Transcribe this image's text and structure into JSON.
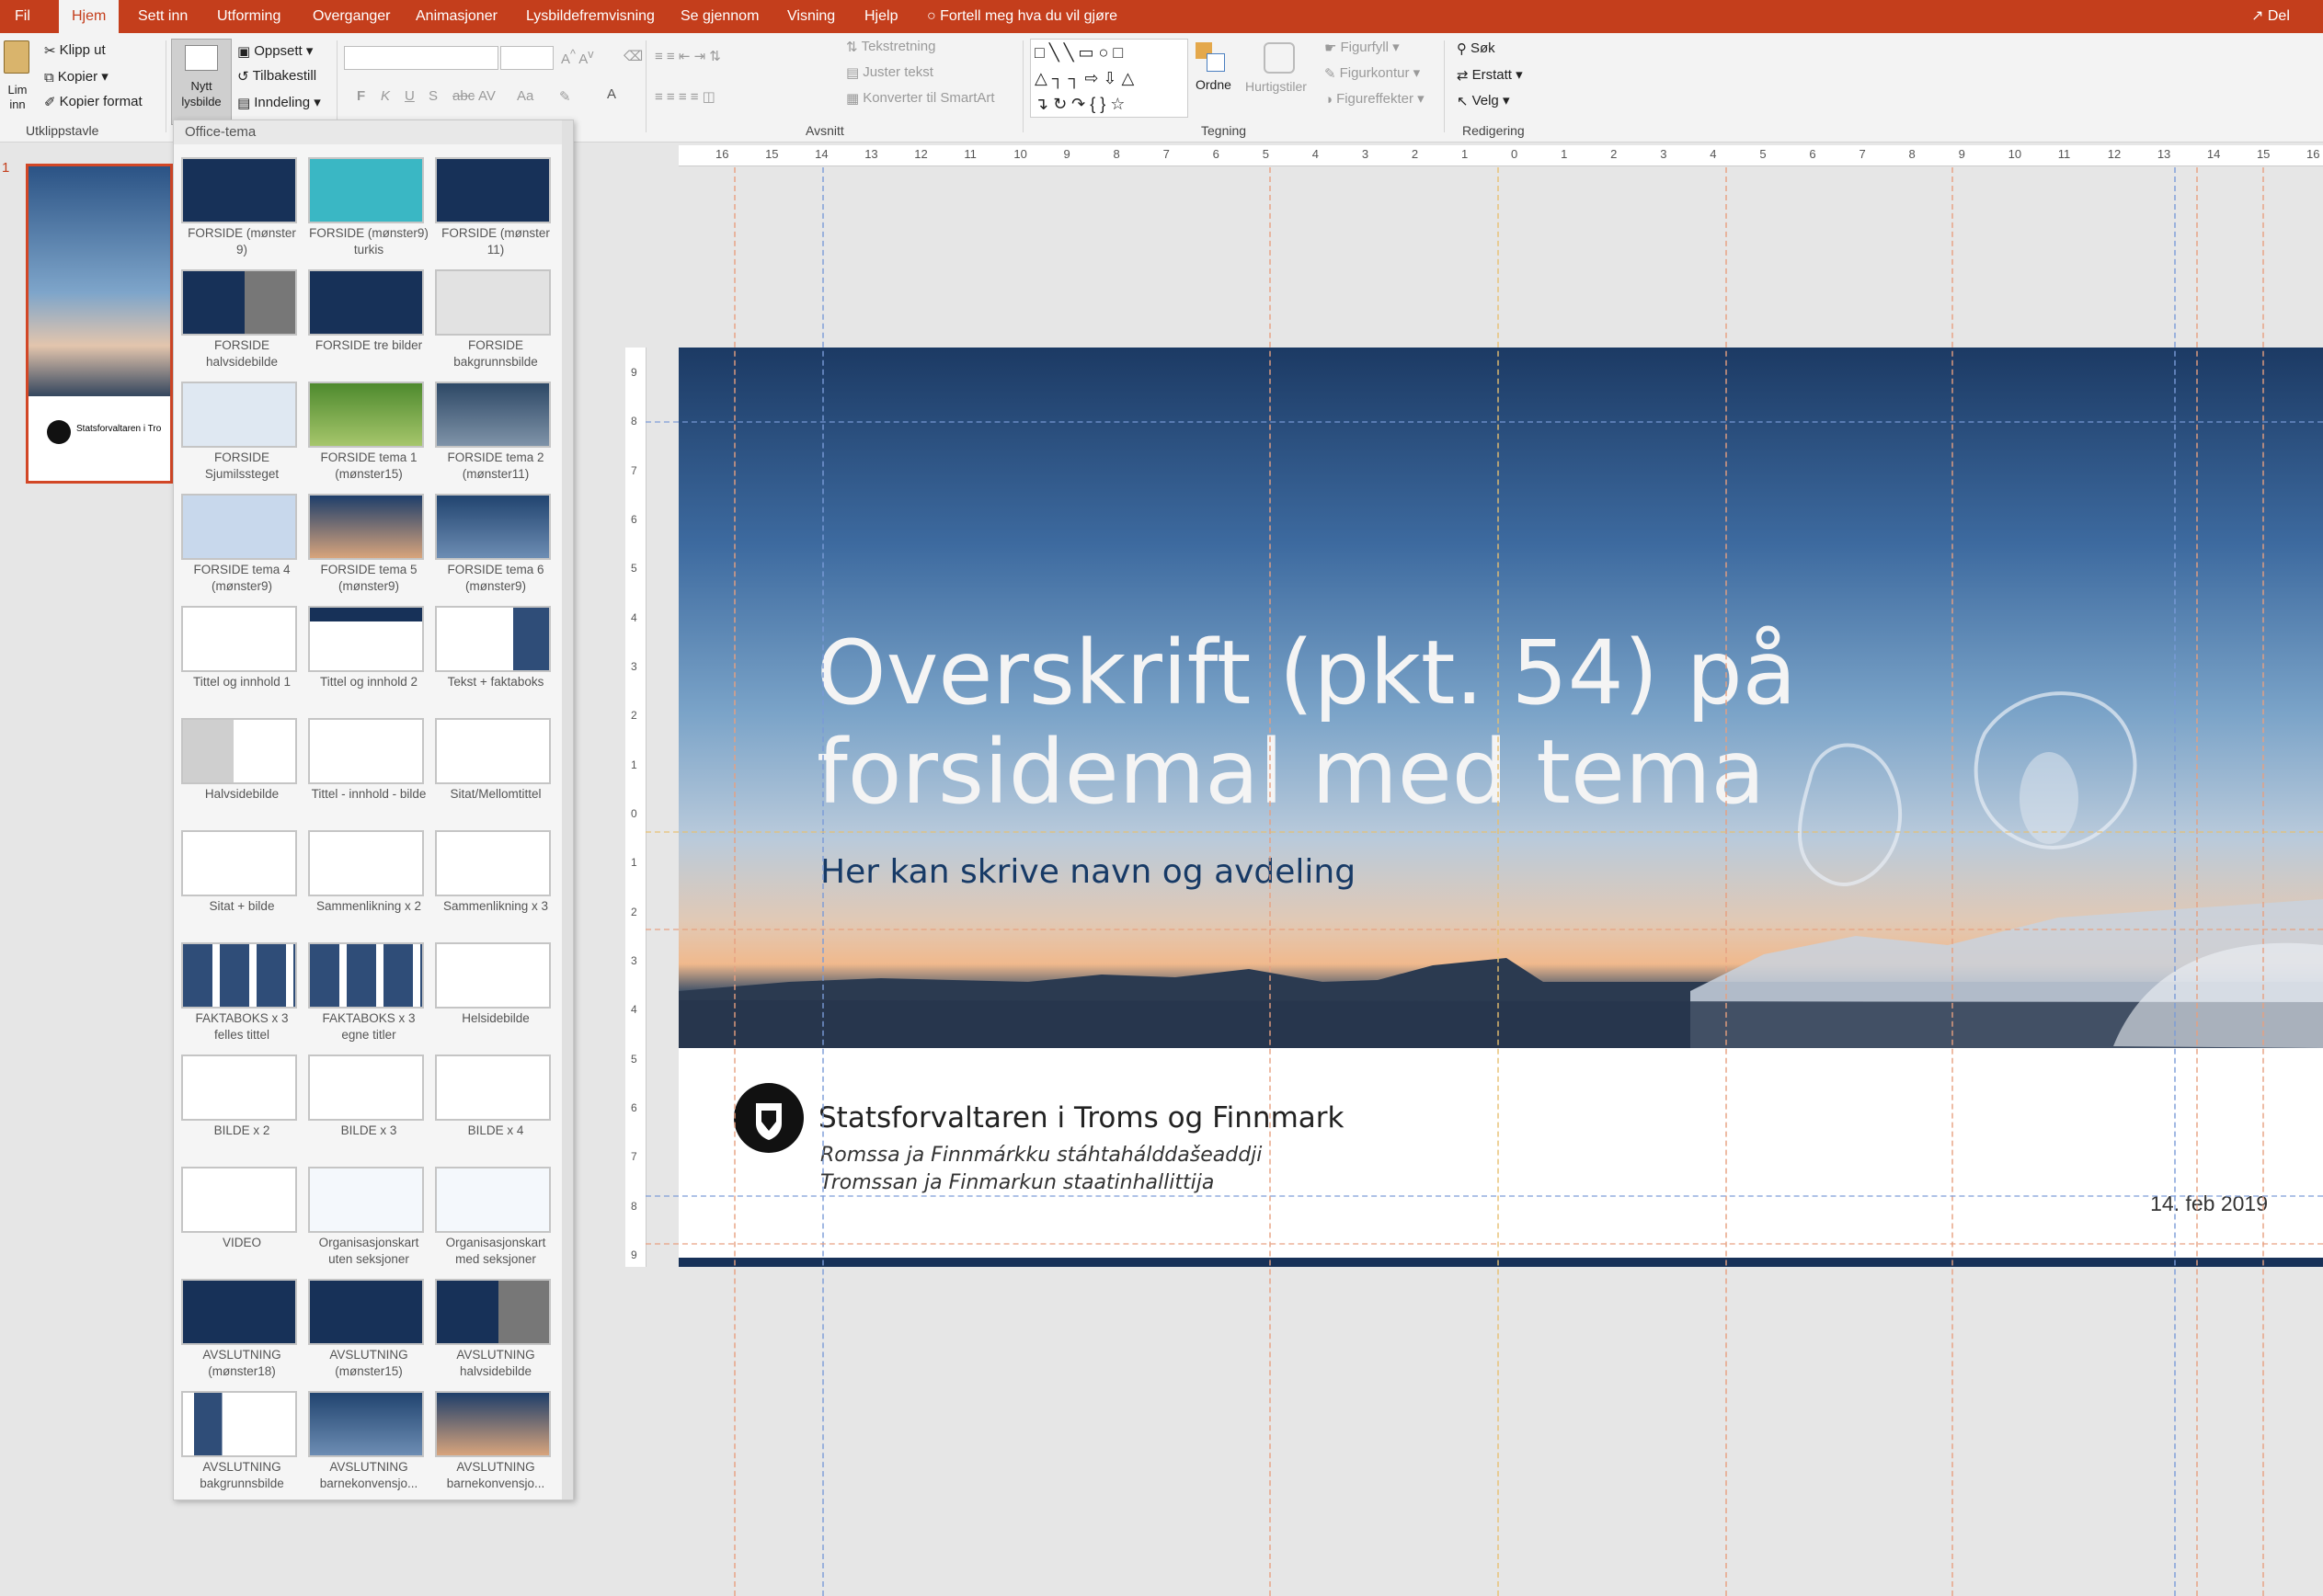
{
  "tabs": [
    "Fil",
    "Hjem",
    "Sett inn",
    "Utforming",
    "Overganger",
    "Animasjoner",
    "Lysbildefremvisning",
    "Se gjennom",
    "Visning",
    "Hjelp"
  ],
  "tell_me": "Fortell meg hva du vil gjøre",
  "share_label": "Del",
  "clipboard": {
    "paste": "Lim inn",
    "cut": "Klipp ut",
    "copy": "Kopier",
    "format_painter": "Kopier format",
    "group": "Utklippstavle"
  },
  "slides_group": {
    "new_slide": "Nytt lysbilde",
    "layout": "Oppsett",
    "reset": "Tilbakestill",
    "section": "Inndeling"
  },
  "font_group": {
    "bold": "F",
    "italic": "K",
    "underline": "U",
    "strike": "S",
    "abc": "abc",
    "av": "AV",
    "aa": "Aa"
  },
  "paragraph_group": {
    "text_direction": "Tekstretning",
    "align_text": "Juster tekst",
    "smartart": "Konverter til SmartArt",
    "group": "Avsnitt"
  },
  "drawing_group": {
    "arrange": "Ordne",
    "quick_styles": "Hurtigstiler",
    "fill": "Figurfyll",
    "outline": "Figurkontur",
    "effects": "Figureffekter",
    "group": "Tegning"
  },
  "editing_group": {
    "find": "Søk",
    "replace": "Erstatt",
    "select": "Velg",
    "group": "Redigering"
  },
  "gallery": {
    "header": "Office-tema",
    "layouts": [
      {
        "caption": "FORSIDE (mønster 9)",
        "style": "dark"
      },
      {
        "caption": "FORSIDE (mønster9) turkis",
        "style": "teal"
      },
      {
        "caption": "FORSIDE (mønster 11)",
        "style": "dark"
      },
      {
        "caption": "FORSIDE halvsidebilde",
        "style": "darkhalf"
      },
      {
        "caption": "FORSIDE tre bilder",
        "style": "darkthree"
      },
      {
        "caption": "FORSIDE bakgrunnsbilde",
        "style": "grey"
      },
      {
        "caption": "FORSIDE Sjumilssteget",
        "style": "light"
      },
      {
        "caption": "FORSIDE tema 1 (mønster15)",
        "style": "green"
      },
      {
        "caption": "FORSIDE tema 2 (mønster11)",
        "style": "mountain"
      },
      {
        "caption": "FORSIDE tema 4 (mønster9)",
        "style": "lightblue"
      },
      {
        "caption": "FORSIDE tema 5 (mønster9)",
        "style": "sky"
      },
      {
        "caption": "FORSIDE tema 6 (mønster9)",
        "style": "people"
      },
      {
        "caption": "Tittel og innhold 1",
        "style": "blank"
      },
      {
        "caption": "Tittel og innhold 2",
        "style": "blankbar"
      },
      {
        "caption": "Tekst + faktaboks",
        "style": "factbox"
      },
      {
        "caption": "Halvsidebilde",
        "style": "half"
      },
      {
        "caption": "Tittel - innhold - bilde",
        "style": "blank"
      },
      {
        "caption": "Sitat/Mellomtittel",
        "style": "blank"
      },
      {
        "caption": "Sitat + bilde",
        "style": "blank"
      },
      {
        "caption": "Sammenlikning x 2",
        "style": "blank"
      },
      {
        "caption": "Sammenlikning x 3",
        "style": "blank"
      },
      {
        "caption": "FAKTABOKS x 3 felles tittel",
        "style": "three"
      },
      {
        "caption": "FAKTABOKS x 3 egne titler",
        "style": "three"
      },
      {
        "caption": "Helsidebilde",
        "style": "blank"
      },
      {
        "caption": "BILDE x 2",
        "style": "blank"
      },
      {
        "caption": "BILDE x 3",
        "style": "blank"
      },
      {
        "caption": "BILDE x 4",
        "style": "blank"
      },
      {
        "caption": "VIDEO",
        "style": "blank"
      },
      {
        "caption": "Organisasjonskart uten seksjoner",
        "style": "org"
      },
      {
        "caption": "Organisasjonskart med seksjoner",
        "style": "org"
      },
      {
        "caption": "AVSLUTNING (mønster18)",
        "style": "dark"
      },
      {
        "caption": "AVSLUTNING (mønster15)",
        "style": "dark"
      },
      {
        "caption": "AVSLUTNING halvsidebilde",
        "style": "darkhalf"
      },
      {
        "caption": "AVSLUTNING bakgrunnsbilde",
        "style": "boxleft"
      },
      {
        "caption": "AVSLUTNING barnekonvensjo...",
        "style": "people"
      },
      {
        "caption": "AVSLUTNING barnekonvensjo...",
        "style": "sky"
      }
    ]
  },
  "thumbnail": {
    "number": "1",
    "org": "Statsforvaltaren i Tro"
  },
  "slide": {
    "title_line1": "Overskrift (pkt. 54) på",
    "title_line2": "forsidemal med tema",
    "subtitle": "Her kan skrive navn og avdeling",
    "org_name": "Statsforvaltaren i Troms og Finnmark",
    "org_sub1": "Romssa ja Finnmárkku stáhtahálddašeaddji",
    "org_sub2": "Tromssan ja Finmarkun staatinhallittija",
    "date": "14. feb 2019"
  },
  "ruler_h": [
    "16",
    "15",
    "14",
    "13",
    "12",
    "11",
    "10",
    "9",
    "8",
    "7",
    "6",
    "5",
    "4",
    "3",
    "2",
    "1",
    "0",
    "1",
    "2",
    "3",
    "4",
    "5",
    "6",
    "7",
    "8",
    "9",
    "10",
    "11",
    "12",
    "13",
    "14",
    "15",
    "16"
  ],
  "ruler_v": [
    "9",
    "8",
    "7",
    "6",
    "5",
    "4",
    "3",
    "2",
    "1",
    "0",
    "1",
    "2",
    "3",
    "4",
    "5",
    "6",
    "7",
    "8",
    "9"
  ]
}
